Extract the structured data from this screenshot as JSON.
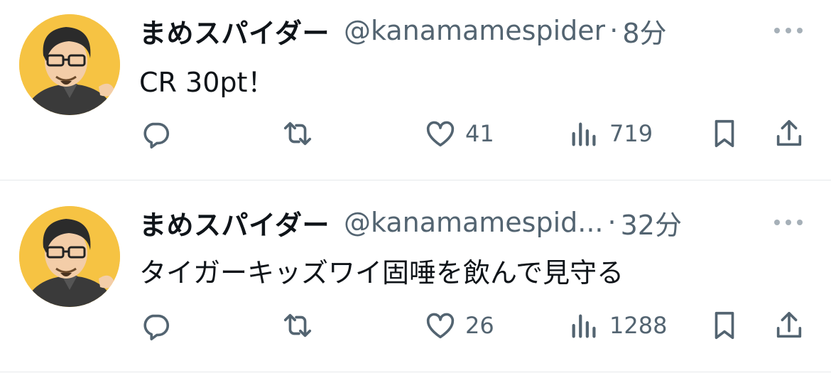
{
  "tweets": [
    {
      "display_name": "まめスパイダー",
      "handle": "@kanamamespider",
      "separator": "·",
      "time": "8分",
      "text": "CR 30pt！",
      "likes": "41",
      "views": "719"
    },
    {
      "display_name": "まめスパイダー",
      "handle": "@kanamamespid...",
      "separator": "·",
      "time": "32分",
      "text": "タイガーキッズワイ固唾を飲んで見守る",
      "likes": "26",
      "views": "1288"
    }
  ],
  "icons": {
    "reply": "reply-icon",
    "retweet": "retweet-icon",
    "like": "heart-icon",
    "views": "views-icon",
    "bookmark": "bookmark-icon",
    "share": "share-icon",
    "more": "more-icon"
  },
  "colors": {
    "text_primary": "#0f1419",
    "text_secondary": "#536471",
    "divider": "#e6e9eb",
    "avatar_background": "#f6c343"
  }
}
